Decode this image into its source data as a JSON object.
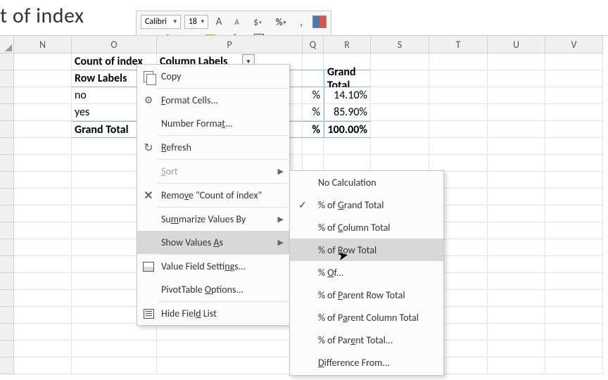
{
  "title_fragment": "t of index",
  "toolbar": {
    "font_name": "Calibri",
    "font_size": "18"
  },
  "columns": {
    "N": "N",
    "O": "O",
    "P": "P",
    "Q": "Q",
    "R": "R",
    "S": "S",
    "T": "T",
    "U": "U",
    "V": "V"
  },
  "pivot": {
    "field_label": "Count of index",
    "col_labels": "Column Labels",
    "row_labels_header": "Row Labels",
    "grand_total_col": "Grand Total",
    "rows": [
      {
        "label": "no",
        "q": "%",
        "gt": "14.10%"
      },
      {
        "label": "yes",
        "q": "%",
        "gt": "85.90%"
      }
    ],
    "grand_total_row": {
      "label": "Grand Total",
      "q": "%",
      "gt": "100.00%"
    }
  },
  "context_menu": {
    "copy": "Copy",
    "format_cells": "Format Cells...",
    "number_format": "Number Format...",
    "refresh": "Refresh",
    "sort": "Sort",
    "remove": "Remove \"Count of index\"",
    "summarize": "Summarize Values By",
    "show_values_as": "Show Values As",
    "value_field_settings": "Value Field Settings...",
    "pivottable_options": "PivotTable Options...",
    "hide_field_list": "Hide Field List"
  },
  "submenu": {
    "no_calc": "No Calculation",
    "pct_grand": "% of Grand Total",
    "pct_col": "% of Column Total",
    "pct_row": "% of Row Total",
    "pct_of": "% Of...",
    "pct_parent_row": "% of Parent Row Total",
    "pct_parent_col": "% of Parent Column Total",
    "pct_parent_total": "% of Parent Total...",
    "diff_from": "Difference From..."
  }
}
